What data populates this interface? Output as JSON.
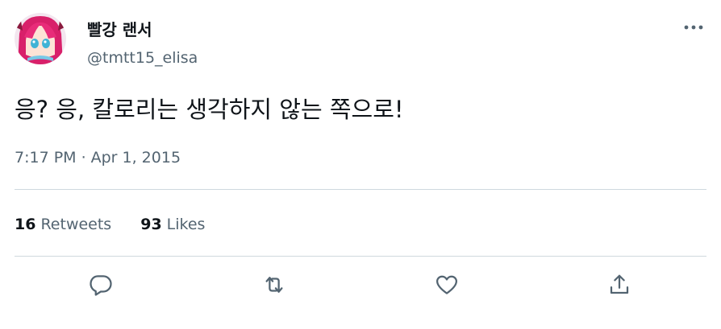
{
  "author": {
    "display_name": "빨강 랜서",
    "handle": "@tmtt15_elisa",
    "avatar_icon": "avatar-pink-hair-character"
  },
  "tweet": {
    "text": "응? 응, 칼로리는 생각하지 않는 쪽으로!",
    "time": "7:17 PM",
    "separator": "·",
    "date": "Apr 1, 2015"
  },
  "stats": {
    "retweets_count": "16",
    "retweets_label": "Retweets",
    "likes_count": "93",
    "likes_label": "Likes"
  },
  "actions": {
    "reply_icon": "reply-icon",
    "retweet_icon": "retweet-icon",
    "like_icon": "heart-icon",
    "share_icon": "share-icon"
  },
  "colors": {
    "text_primary": "#0f1419",
    "text_secondary": "#536471",
    "divider": "#cfd9de"
  }
}
